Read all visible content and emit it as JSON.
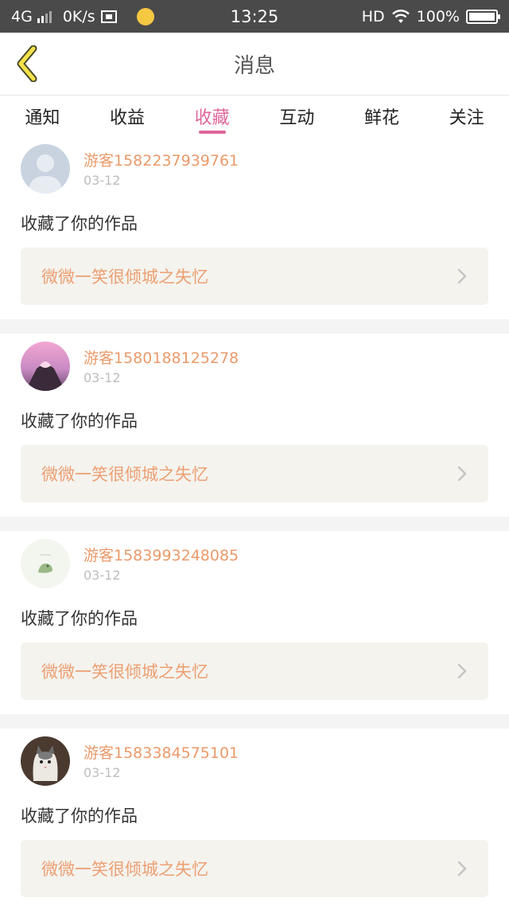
{
  "status_bar": {
    "network": "4G",
    "speed": "0K/s",
    "time": "13:25",
    "hd": "HD",
    "battery": "100%",
    "battery_level": 1.0
  },
  "header": {
    "title": "消息",
    "back_icon": "chevron-left-icon"
  },
  "tabs": [
    {
      "label": "通知",
      "active": false
    },
    {
      "label": "收益",
      "active": false
    },
    {
      "label": "收藏",
      "active": true
    },
    {
      "label": "互动",
      "active": false
    },
    {
      "label": "鲜花",
      "active": false
    },
    {
      "label": "关注",
      "active": false
    }
  ],
  "colors": {
    "accent": "#e0659a",
    "username": "#ea9a6a",
    "work_title": "#ec9f72",
    "work_box_bg": "#f4f3ee"
  },
  "messages": [
    {
      "username": "游客1582237939761",
      "date": "03-12",
      "action": "收藏了你的作品",
      "work_title": "微微一笑很倾城之失忆",
      "avatar": "default-user-avatar"
    },
    {
      "username": "游客1580188125278",
      "date": "03-12",
      "action": "收藏了你的作品",
      "work_title": "微微一笑很倾城之失忆",
      "avatar": "pink-sky-hands-avatar"
    },
    {
      "username": "游客1583993248085",
      "date": "03-12",
      "action": "收藏了你的作品",
      "work_title": "微微一笑很倾城之失忆",
      "avatar": "green-bird-avatar"
    },
    {
      "username": "游客1583384575101",
      "date": "03-12",
      "action": "收藏了你的作品",
      "work_title": "微微一笑很倾城之失忆",
      "avatar": "cat-avatar"
    }
  ]
}
